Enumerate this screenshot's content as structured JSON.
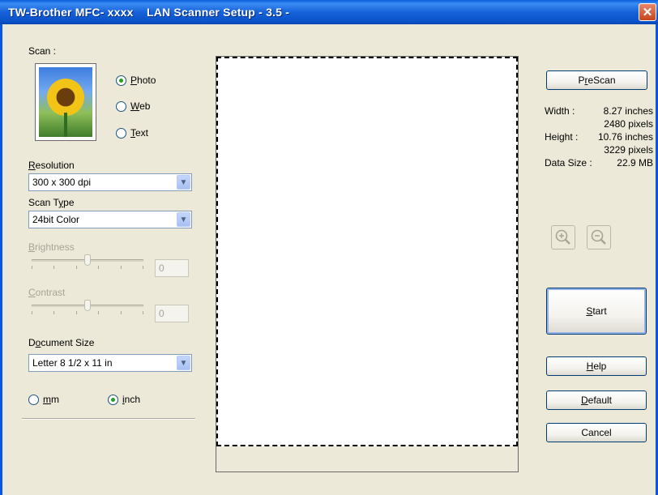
{
  "window": {
    "title": "TW-Brother MFC- xxxx    LAN Scanner Setup - 3.5 -",
    "close_glyph": "✕"
  },
  "scan": {
    "label": "Scan :",
    "options": [
      {
        "label": "Photo",
        "mnemonic": "P",
        "rest": "hoto",
        "checked": true
      },
      {
        "label": "Web",
        "mnemonic": "W",
        "rest": "eb",
        "checked": false
      },
      {
        "label": "Text",
        "mnemonic": "T",
        "rest": "ext",
        "checked": false
      }
    ]
  },
  "resolution": {
    "label_mn": "R",
    "label_rest": "esolution",
    "value": "300 x 300 dpi"
  },
  "scan_type": {
    "label_pre": "Scan T",
    "label_mn": "y",
    "label_rest": "pe",
    "value": "24bit Color"
  },
  "brightness": {
    "label_mn": "B",
    "label_rest": "rightness",
    "value": "0",
    "level": 0.5
  },
  "contrast": {
    "label_mn": "C",
    "label_rest": "ontrast",
    "value": "0",
    "level": 0.5
  },
  "document_size": {
    "label_pre": "D",
    "label_mn": "o",
    "label_rest": "cument Size",
    "value": "Letter 8 1/2 x 11 in"
  },
  "units": {
    "mm": {
      "mn": "m",
      "rest": "m",
      "checked": false
    },
    "inch": {
      "mn": "i",
      "rest": "nch",
      "checked": true
    }
  },
  "buttons": {
    "prescan": {
      "pre": "P",
      "mn": "r",
      "rest": "eScan"
    },
    "start": {
      "mn": "S",
      "rest": "tart"
    },
    "help": {
      "mn": "H",
      "rest": "elp"
    },
    "default": {
      "mn": "D",
      "rest": "efault"
    },
    "cancel": "Cancel"
  },
  "info": {
    "width_label": "Width :",
    "width_value": "8.27 inches",
    "width_pixels": "2480 pixels",
    "height_label": "Height :",
    "height_value": "10.76 inches",
    "height_pixels": "3229 pixels",
    "datasize_label": "Data Size :",
    "datasize_value": "22.9 MB"
  },
  "icons": {
    "zoom_in": "zoom-in-icon",
    "zoom_out": "zoom-out-icon",
    "dropdown": "chevron-down-icon"
  },
  "colors": {
    "titlebar": "#0a55e4",
    "dialog_bg": "#ece9d8",
    "radio_check": "#21a121"
  }
}
